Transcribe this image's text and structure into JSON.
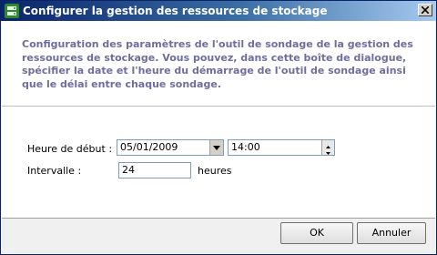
{
  "window": {
    "title": "Configurer la gestion des ressources de stockage"
  },
  "header": {
    "description": "Configuration des paramètres de l'outil de sondage de la gestion des ressources de stockage. Vous pouvez, dans cette boîte de dialogue, spécifier la date et l'heure du démarrage de l'outil de sondage ainsi que le délai entre chaque sondage."
  },
  "form": {
    "start_label": "Heure de début :",
    "start_date": "05/01/2009",
    "start_time": "14:00",
    "interval_label": "Intervalle :",
    "interval_value": "24",
    "interval_unit": "heures"
  },
  "buttons": {
    "ok": "OK",
    "cancel": "Annuler"
  },
  "icons": {
    "app": "server-app-icon",
    "close": "close-icon",
    "dropdown": "chevron-down-icon",
    "spin_up": "spin-up-icon",
    "spin_down": "spin-down-icon"
  },
  "colors": {
    "title_start": "#0a246a",
    "title_end": "#a6caf0",
    "description_text": "#6e6d9c"
  }
}
